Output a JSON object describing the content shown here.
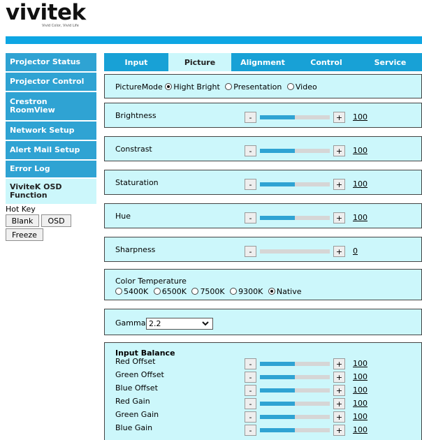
{
  "brand": {
    "name": "vivitek",
    "tagline": "Vivid Color, Vivid Life"
  },
  "sidebar": {
    "items": [
      {
        "label": "Projector Status"
      },
      {
        "label": "Projector Control"
      },
      {
        "label": "Crestron RoomView"
      },
      {
        "label": "Network Setup"
      },
      {
        "label": "Alert Mail Setup"
      },
      {
        "label": "Error Log"
      },
      {
        "label": "ViviteK OSD Function"
      }
    ],
    "active_index": 6,
    "hotkey": {
      "label": "Hot Key",
      "buttons": [
        {
          "label": "Blank"
        },
        {
          "label": "OSD"
        },
        {
          "label": "Freeze"
        }
      ]
    }
  },
  "tabs": [
    {
      "label": "Input"
    },
    {
      "label": "Picture"
    },
    {
      "label": "Alignment"
    },
    {
      "label": "Control"
    },
    {
      "label": "Service"
    }
  ],
  "active_tab": 1,
  "picture_mode": {
    "label": "PictureMode",
    "options": [
      "Hight Bright",
      "Presentation",
      "Video"
    ],
    "selected": 0
  },
  "sliders": [
    {
      "label": "Brightness",
      "value": "100",
      "fraction": 0.5
    },
    {
      "label": "Constrast",
      "value": "100",
      "fraction": 0.5
    },
    {
      "label": "Staturation",
      "value": "100",
      "fraction": 0.5
    },
    {
      "label": "Hue",
      "value": "100",
      "fraction": 0.5
    },
    {
      "label": "Sharpness",
      "value": "0",
      "fraction": 0.0
    }
  ],
  "color_temperature": {
    "label": "Color Temperature",
    "options": [
      "5400K",
      "6500K",
      "7500K",
      "9300K",
      "Native"
    ],
    "selected": 4
  },
  "gamma": {
    "label": "Gamma",
    "value": "2.2"
  },
  "input_balance": {
    "title": "Input Balance",
    "rows": [
      {
        "label": "Red Offset",
        "value": "100",
        "fraction": 0.5
      },
      {
        "label": "Green Offset",
        "value": "100",
        "fraction": 0.5
      },
      {
        "label": "Blue Offset",
        "value": "100",
        "fraction": 0.5
      },
      {
        "label": "Red Gain",
        "value": "100",
        "fraction": 0.5
      },
      {
        "label": "Green Gain",
        "value": "100",
        "fraction": 0.5
      },
      {
        "label": "Blue Gain",
        "value": "100",
        "fraction": 0.5
      }
    ]
  },
  "controls": {
    "minus": "-",
    "plus": "+"
  },
  "colors": {
    "accent": "#2fa3d3",
    "panel": "#ccf7fb",
    "topbar": "#0ea6e3"
  }
}
